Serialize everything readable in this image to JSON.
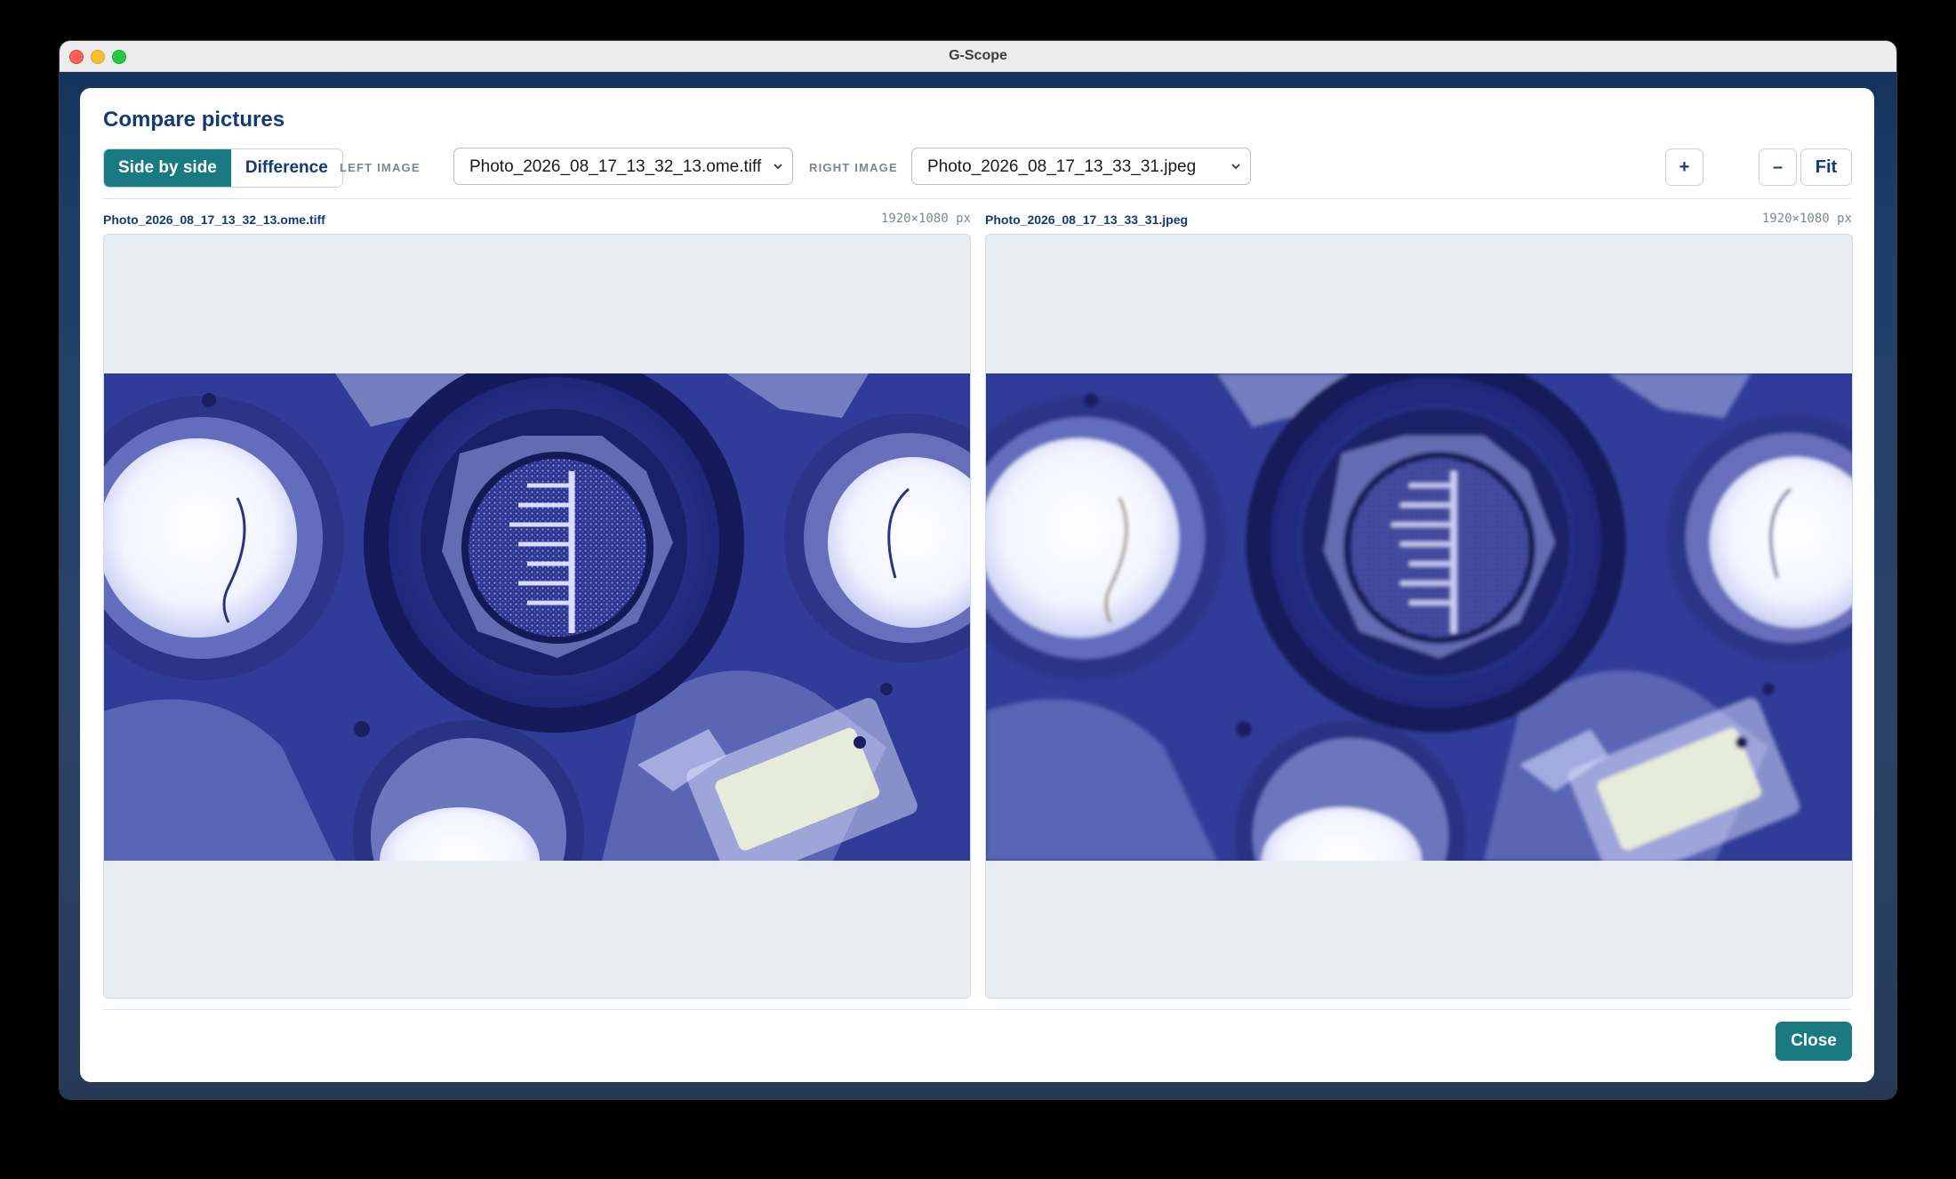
{
  "window": {
    "title": "G-Scope"
  },
  "dialog": {
    "title": "Compare pictures",
    "modes": [
      {
        "label": "Side by side",
        "active": true
      },
      {
        "label": "Difference",
        "active": false
      }
    ],
    "left_image_label": "LEFT IMAGE",
    "left_image_value": "Photo_2026_08_17_13_32_13.ome.tiff",
    "right_image_label": "RIGHT IMAGE",
    "right_image_value": "Photo_2026_08_17_13_33_31.jpeg",
    "zoom_in_label": "+",
    "zoom_out_label": "–",
    "fit_label": "Fit",
    "close_label": "Close"
  },
  "panes": {
    "left": {
      "name": "Photo_2026_08_17_13_32_13.ome.tiff",
      "dimensions": "1920×1080 px"
    },
    "right": {
      "name": "Photo_2026_08_17_13_33_31.jpeg",
      "dimensions": "1920×1080 px"
    }
  },
  "colors": {
    "accent": "#197a82",
    "heading": "#123a78",
    "pane_background": "#e8ecf3"
  }
}
